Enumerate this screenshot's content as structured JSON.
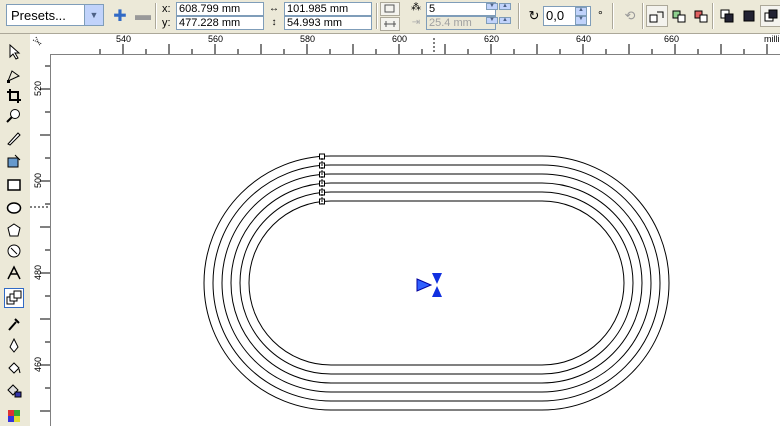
{
  "propbar": {
    "presets_value": "Presets...",
    "x_label": "x:",
    "x_value": "608.799 mm",
    "y_label": "y:",
    "y_value": "477.228 mm",
    "width_value": "101.985 mm",
    "height_value": "54.993 mm",
    "steps_value": "5",
    "offset_value": "25.4 mm",
    "angle_value": "0,0",
    "angle_unit": "°"
  },
  "ruler": {
    "h_ticks": [
      "540",
      "560",
      "580",
      "600",
      "620",
      "640",
      "660"
    ],
    "h_unit": "milli",
    "v_ticks": [
      "520",
      "500",
      "480",
      "460"
    ]
  },
  "icons": {
    "add_preset": "plus-icon",
    "remove_preset": "minus-icon",
    "blend_direction": "rotate-icon"
  }
}
